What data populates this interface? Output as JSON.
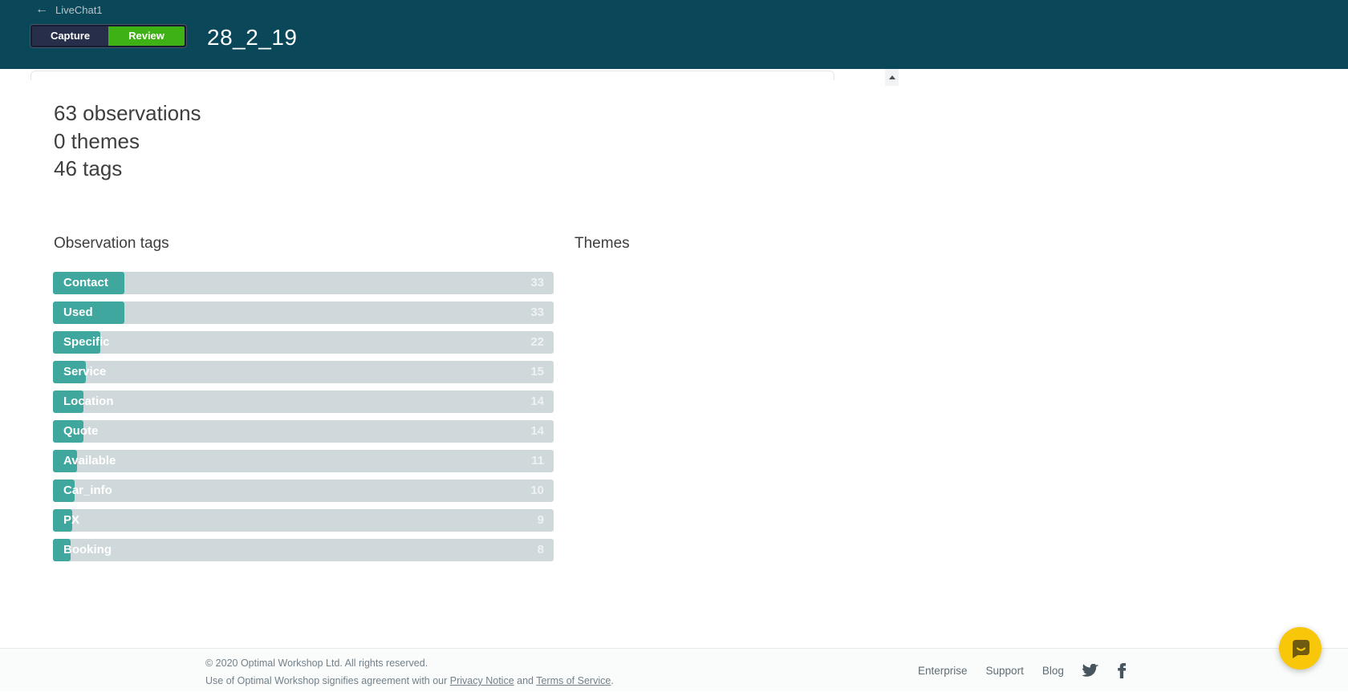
{
  "header": {
    "back_arrow": "←",
    "back_label": "LiveChat1",
    "tabs": [
      {
        "label": "Capture",
        "active": false
      },
      {
        "label": "Review",
        "active": true
      }
    ],
    "session_title": "28_2_19"
  },
  "stats": {
    "lines": [
      "63 observations",
      "0 themes",
      "46 tags"
    ]
  },
  "sections": {
    "tags_heading": "Observation tags",
    "themes_heading": "Themes"
  },
  "chart_data": {
    "type": "bar",
    "orientation": "horizontal",
    "title": "Observation tags",
    "categories": [
      "Contact",
      "Used",
      "Specific",
      "Service",
      "Location",
      "Quote",
      "Available",
      "Car_info",
      "PX",
      "Booking"
    ],
    "values": [
      33,
      33,
      22,
      15,
      14,
      14,
      11,
      10,
      9,
      8
    ],
    "legend": false,
    "grid": false
  },
  "tags": {
    "items": [
      {
        "label": "Contact",
        "count": 33
      },
      {
        "label": "Used",
        "count": 33
      },
      {
        "label": "Specific",
        "count": 22
      },
      {
        "label": "Service",
        "count": 15
      },
      {
        "label": "Location",
        "count": 14
      },
      {
        "label": "Quote",
        "count": 14
      },
      {
        "label": "Available",
        "count": 11
      },
      {
        "label": "Car_info",
        "count": 10
      },
      {
        "label": "PX",
        "count": 9
      },
      {
        "label": "Booking",
        "count": 8
      }
    ]
  },
  "themes": {
    "items": []
  },
  "footer": {
    "copyright": "© 2020 Optimal Workshop Ltd. All rights reserved.",
    "agreement_prefix": "Use of Optimal Workshop signifies agreement with our ",
    "privacy_link": "Privacy Notice",
    "agreement_mid": " and ",
    "terms_link": "Terms of Service",
    "agreement_suffix": ".",
    "links": [
      "Enterprise",
      "Support",
      "Blog"
    ]
  },
  "colors": {
    "header_bg": "#0a4759",
    "tab_inactive": "#272e4a",
    "accent_green": "#3eb114",
    "bar_teal": "#3fa79d",
    "bar_gray": "#cfd8da",
    "intercom_yellow": "#f8c70a"
  }
}
